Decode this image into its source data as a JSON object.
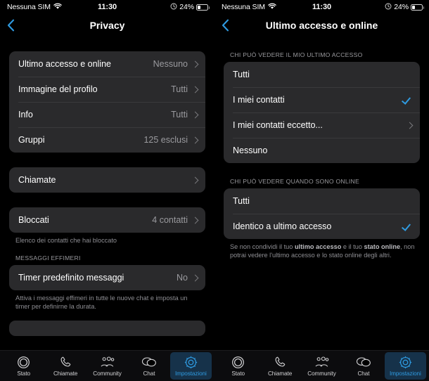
{
  "status_bar": {
    "carrier": "Nessuna SIM",
    "wifi_icon": "wifi-icon",
    "time": "11:30",
    "alarm_icon": "alarm-icon",
    "battery_percent": "24%",
    "battery_icon": "battery-icon"
  },
  "left_screen": {
    "nav": {
      "back_icon": "chevron-left-icon",
      "title": "Privacy"
    },
    "group1": [
      {
        "label": "Ultimo accesso e online",
        "value": "Nessuno",
        "accessory": "chevron"
      },
      {
        "label": "Immagine del profilo",
        "value": "Tutti",
        "accessory": "chevron"
      },
      {
        "label": "Info",
        "value": "Tutti",
        "accessory": "chevron"
      },
      {
        "label": "Gruppi",
        "value": "125 esclusi",
        "accessory": "chevron"
      }
    ],
    "group2": [
      {
        "label": "Chiamate",
        "value": "",
        "accessory": "chevron"
      }
    ],
    "group3": [
      {
        "label": "Bloccati",
        "value": "4 contatti",
        "accessory": "chevron"
      }
    ],
    "group3_footnote": "Elenco dei contatti che hai bloccato",
    "ephemeral_header": "MESSAGGI EFFIMERI",
    "group4": [
      {
        "label": "Timer predefinito messaggi",
        "value": "No",
        "accessory": "chevron"
      }
    ],
    "group4_footnote_1": "Attiva i messaggi effimeri in tutte le nuove chat e",
    "group4_footnote_2": "imposta un timer per definirne la durata."
  },
  "right_screen": {
    "nav": {
      "back_icon": "chevron-left-icon",
      "title": "Ultimo accesso e online"
    },
    "section1_header": "CHI PUÒ VEDERE IL MIO ULTIMO ACCESSO",
    "section1": [
      {
        "label": "Tutti",
        "accessory": "none"
      },
      {
        "label": "I miei contatti",
        "accessory": "check"
      },
      {
        "label": "I miei contatti eccetto...",
        "accessory": "chevron"
      },
      {
        "label": "Nessuno",
        "accessory": "none"
      }
    ],
    "section2_header": "CHI PUÒ VEDERE QUANDO SONO ONLINE",
    "section2": [
      {
        "label": "Tutti",
        "accessory": "none"
      },
      {
        "label": "Identico a ultimo accesso",
        "accessory": "check"
      }
    ],
    "section2_footnote": {
      "part1": "Se non condividi il tuo ",
      "bold1": "ultimo accesso",
      "part2": " e il tuo ",
      "bold2": "stato online",
      "part3": ", non potrai vedere l'ultimo accesso e lo stato online degli altri."
    }
  },
  "tab_bar": {
    "items": [
      {
        "label": "Stato",
        "icon": "status-rings-icon",
        "active": false
      },
      {
        "label": "Chiamate",
        "icon": "phone-icon",
        "active": false
      },
      {
        "label": "Community",
        "icon": "community-people-icon",
        "active": false
      },
      {
        "label": "Chat",
        "icon": "chat-bubbles-icon",
        "active": false
      },
      {
        "label": "Impostazioni",
        "icon": "gear-icon",
        "active": true
      }
    ]
  },
  "colors": {
    "background": "#000000",
    "card": "#2a2a2c",
    "accent_blue": "#2f9ae0",
    "active_tab_bg": "#16324a",
    "secondary_text": "#9a9a9e",
    "separator": "#3a3a3c"
  }
}
